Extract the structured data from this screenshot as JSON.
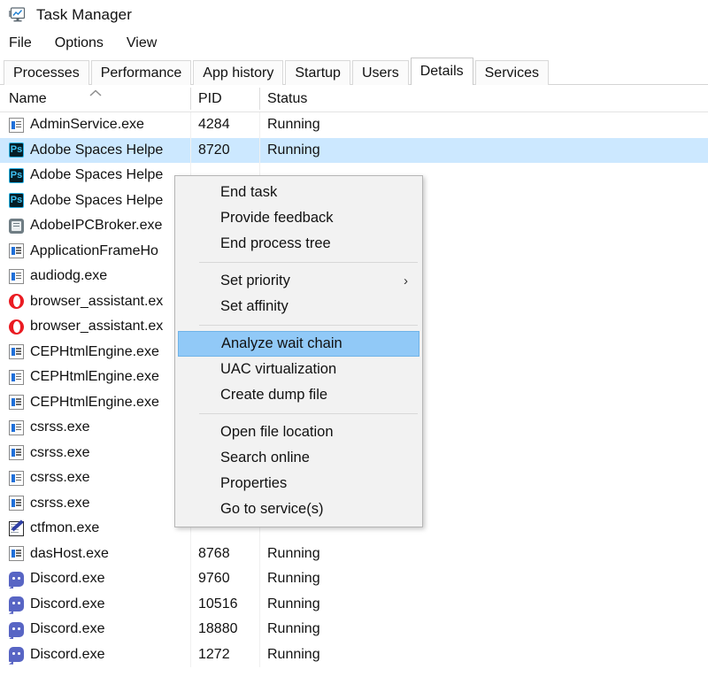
{
  "window": {
    "title": "Task Manager",
    "icon": "task-manager-icon"
  },
  "menubar": {
    "items": [
      {
        "label": "File"
      },
      {
        "label": "Options"
      },
      {
        "label": "View"
      }
    ]
  },
  "tabs": {
    "active": "Details",
    "items": [
      {
        "label": "Processes"
      },
      {
        "label": "Performance"
      },
      {
        "label": "App history"
      },
      {
        "label": "Startup"
      },
      {
        "label": "Users"
      },
      {
        "label": "Details"
      },
      {
        "label": "Services"
      }
    ]
  },
  "table": {
    "columns": [
      {
        "label": "Name",
        "sort": "ascending",
        "sort_icon": "sort-ascending-caret"
      },
      {
        "label": "PID",
        "sort": "none"
      },
      {
        "label": "Status",
        "sort": "none"
      }
    ],
    "rows": [
      {
        "name": "AdminService.exe",
        "pid": "4284",
        "status": "Running",
        "icon": "app-window-icon",
        "selected": false
      },
      {
        "name": "Adobe Spaces Helpe",
        "pid": "8720",
        "status": "Running",
        "icon": "photoshop-ps-icon",
        "selected": true
      },
      {
        "name": "Adobe Spaces Helpe",
        "pid": "",
        "status": "",
        "icon": "photoshop-ps-icon",
        "selected": false
      },
      {
        "name": "Adobe Spaces Helpe",
        "pid": "",
        "status": "",
        "icon": "photoshop-ps-icon",
        "selected": false
      },
      {
        "name": "AdobeIPCBroker.exe",
        "pid": "",
        "status": "",
        "icon": "adobe-broker-icon",
        "selected": false
      },
      {
        "name": "ApplicationFrameHo",
        "pid": "",
        "status": "",
        "icon": "app-window-icon",
        "selected": false
      },
      {
        "name": "audiodg.exe",
        "pid": "",
        "status": "",
        "icon": "app-window-icon",
        "selected": false
      },
      {
        "name": "browser_assistant.ex",
        "pid": "",
        "status": "",
        "icon": "opera-ring-icon",
        "selected": false
      },
      {
        "name": "browser_assistant.ex",
        "pid": "",
        "status": "",
        "icon": "opera-ring-icon",
        "selected": false
      },
      {
        "name": "CEPHtmlEngine.exe",
        "pid": "",
        "status": "",
        "icon": "app-window-icon",
        "selected": false
      },
      {
        "name": "CEPHtmlEngine.exe",
        "pid": "",
        "status": "",
        "icon": "app-window-icon",
        "selected": false
      },
      {
        "name": "CEPHtmlEngine.exe",
        "pid": "",
        "status": "",
        "icon": "app-window-icon",
        "selected": false
      },
      {
        "name": "csrss.exe",
        "pid": "",
        "status": "",
        "icon": "app-window-icon",
        "selected": false
      },
      {
        "name": "csrss.exe",
        "pid": "",
        "status": "",
        "icon": "app-window-icon",
        "selected": false
      },
      {
        "name": "csrss.exe",
        "pid": "",
        "status": "",
        "icon": "app-window-icon",
        "selected": false
      },
      {
        "name": "csrss.exe",
        "pid": "",
        "status": "",
        "icon": "app-window-icon",
        "selected": false
      },
      {
        "name": "ctfmon.exe",
        "pid": "",
        "status": "",
        "icon": "ctfmon-pen-icon",
        "selected": false
      },
      {
        "name": "dasHost.exe",
        "pid": "8768",
        "status": "Running",
        "icon": "app-window-icon",
        "selected": false
      },
      {
        "name": "Discord.exe",
        "pid": "9760",
        "status": "Running",
        "icon": "discord-icon",
        "selected": false
      },
      {
        "name": "Discord.exe",
        "pid": "10516",
        "status": "Running",
        "icon": "discord-icon",
        "selected": false
      },
      {
        "name": "Discord.exe",
        "pid": "18880",
        "status": "Running",
        "icon": "discord-icon",
        "selected": false
      },
      {
        "name": "Discord.exe",
        "pid": "1272",
        "status": "Running",
        "icon": "discord-icon",
        "selected": false
      }
    ]
  },
  "context_menu": {
    "highlighted": "Analyze wait chain",
    "items": [
      {
        "label": "End task",
        "type": "item"
      },
      {
        "label": "Provide feedback",
        "type": "item"
      },
      {
        "label": "End process tree",
        "type": "item"
      },
      {
        "type": "separator"
      },
      {
        "label": "Set priority",
        "type": "submenu",
        "submenu_icon": "chevron-right-icon"
      },
      {
        "label": "Set affinity",
        "type": "item"
      },
      {
        "type": "separator"
      },
      {
        "label": "Analyze wait chain",
        "type": "item",
        "highlighted": true
      },
      {
        "label": "UAC virtualization",
        "type": "item"
      },
      {
        "label": "Create dump file",
        "type": "item"
      },
      {
        "type": "separator"
      },
      {
        "label": "Open file location",
        "type": "item"
      },
      {
        "label": "Search online",
        "type": "item"
      },
      {
        "label": "Properties",
        "type": "item"
      },
      {
        "label": "Go to service(s)",
        "type": "item"
      }
    ]
  },
  "colors": {
    "selection_row": "#cce8ff",
    "menu_highlight": "#91c9f7",
    "menu_background": "#f2f2f2",
    "window_background": "#ffffff"
  }
}
